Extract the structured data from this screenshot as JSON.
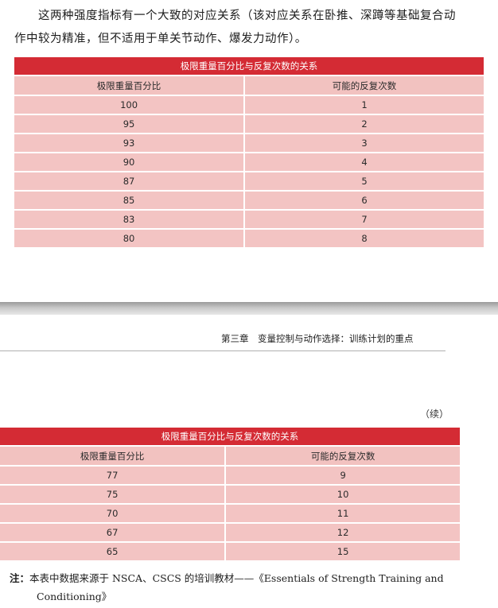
{
  "intro": {
    "line1": "这两种强度指标有一个大致的对应关系（该对应关系在卧推、深蹲等基础复合动",
    "line2": "作中较为精准，但不适用于单关节动作、爆发力动作）。"
  },
  "table1": {
    "title": "极限重量百分比与反复次数的关系",
    "col1_header": "极限重量百分比",
    "col2_header": "可能的反复次数",
    "rows": [
      [
        "100",
        "1"
      ],
      [
        "95",
        "2"
      ],
      [
        "93",
        "3"
      ],
      [
        "90",
        "4"
      ],
      [
        "87",
        "5"
      ],
      [
        "85",
        "6"
      ],
      [
        "83",
        "7"
      ],
      [
        "80",
        "8"
      ]
    ]
  },
  "running_header": "第三章　变量控制与动作选择：训练计划的重点",
  "continued_label": "（续）",
  "table2": {
    "title": "极限重量百分比与反复次数的关系",
    "col1_header": "极限重量百分比",
    "col2_header": "可能的反复次数",
    "rows": [
      [
        "77",
        "9"
      ],
      [
        "75",
        "10"
      ],
      [
        "70",
        "11"
      ],
      [
        "67",
        "12"
      ],
      [
        "65",
        "15"
      ]
    ]
  },
  "note": {
    "label": "注：",
    "text_line1": "本表中数据来源于 NSCA、CSCS 的培训教材——《Essentials of Strength Training and",
    "text_line2": "Conditioning》"
  }
}
